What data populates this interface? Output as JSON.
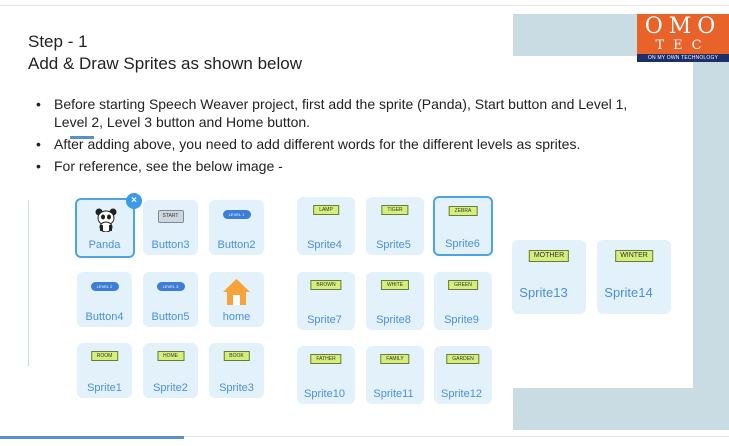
{
  "heading": {
    "step": "Step - 1",
    "subtitle": "Add & Draw Sprites as shown below"
  },
  "bullets": [
    "Before starting Speech Weaver project, first add the sprite (Panda), Start button and Level 1, Level 2, Level 3 button and Home button.",
    "After adding above, you need to add different words for the different levels as sprites.",
    "For reference, see the below image -"
  ],
  "logo": {
    "top": "OMO",
    "middle": "TEC",
    "tagline": "ON MY OWN TECHNOLOGY",
    "colors": {
      "background": "#e8622a",
      "band": "#1c2f6b"
    }
  },
  "sprites": {
    "panda": {
      "name": "Panda",
      "icon": "panda-icon"
    },
    "button3": {
      "name": "Button3",
      "label": "START"
    },
    "button2": {
      "name": "Button2",
      "label": "LEVEL 1"
    },
    "button4": {
      "name": "Button4",
      "label": "LEVEL 2"
    },
    "button5": {
      "name": "Button5",
      "label": "LEVEL 3"
    },
    "home": {
      "name": "home",
      "icon": "house-icon"
    },
    "sprite1": {
      "name": "Sprite1",
      "word": "ROOM"
    },
    "sprite2": {
      "name": "Sprite2",
      "word": "HOME"
    },
    "sprite3": {
      "name": "Sprite3",
      "word": "BOOK"
    },
    "sprite4": {
      "name": "Sprite4",
      "word": "LAMP"
    },
    "sprite5": {
      "name": "Sprite5",
      "word": "TIGER"
    },
    "sprite6": {
      "name": "Sprite6",
      "word": "ZEBRA"
    },
    "sprite7": {
      "name": "Sprite7",
      "word": "BROWN"
    },
    "sprite8": {
      "name": "Sprite8",
      "word": "WHITE"
    },
    "sprite9": {
      "name": "Sprite9",
      "word": "GREEN"
    },
    "sprite10": {
      "name": "Sprite10",
      "word": "FATHER"
    },
    "sprite11": {
      "name": "Sprite11",
      "word": "FAMILY"
    },
    "sprite12": {
      "name": "Sprite12",
      "word": "GARDEN"
    },
    "sprite13": {
      "name": "Sprite13",
      "word": "MOTHER"
    },
    "sprite14": {
      "name": "Sprite14",
      "word": "WINTER"
    }
  },
  "selected_badge": "×"
}
